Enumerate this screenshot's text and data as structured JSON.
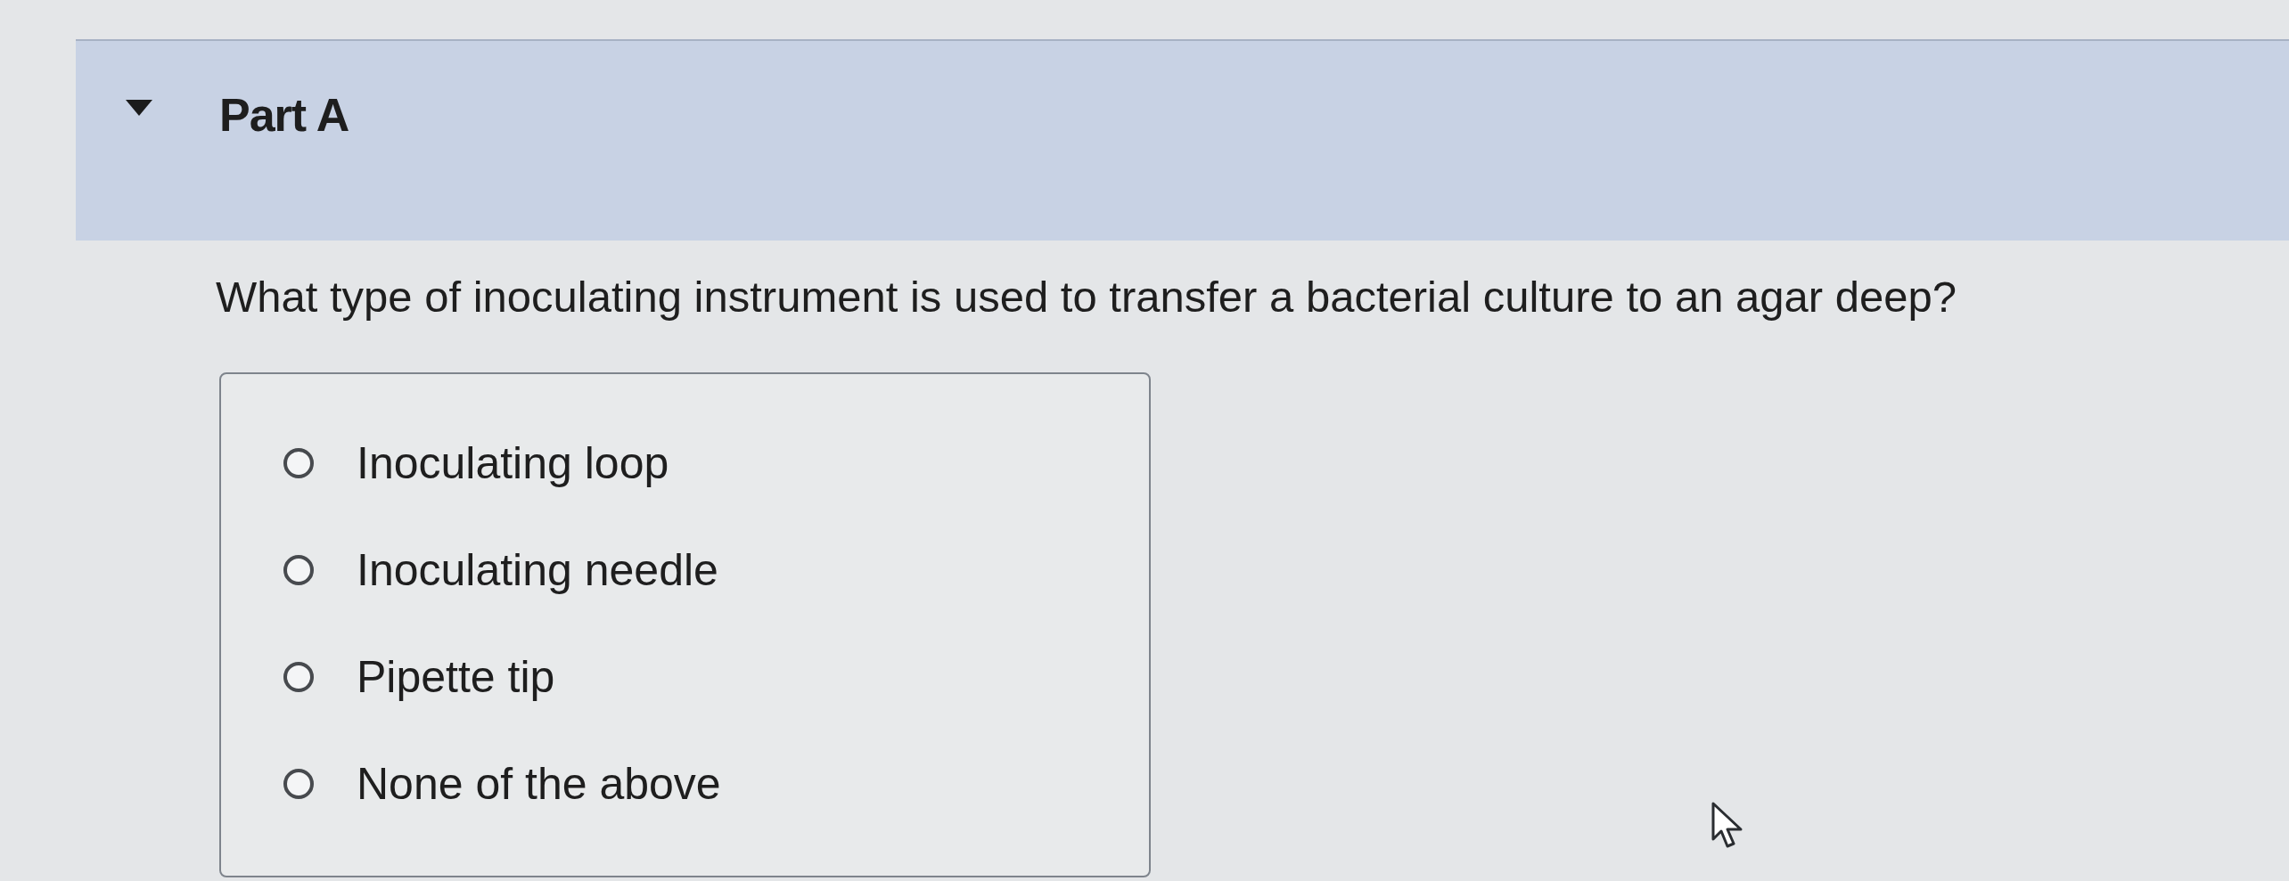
{
  "section": {
    "title": "Part A",
    "expanded": true
  },
  "question": {
    "text": "What type of inoculating instrument is used to transfer a bacterial culture to an agar deep?"
  },
  "options": [
    {
      "label": "Inoculating loop",
      "selected": false
    },
    {
      "label": "Inoculating needle",
      "selected": false
    },
    {
      "label": "Pipette tip",
      "selected": false
    },
    {
      "label": "None of the above",
      "selected": false
    }
  ]
}
